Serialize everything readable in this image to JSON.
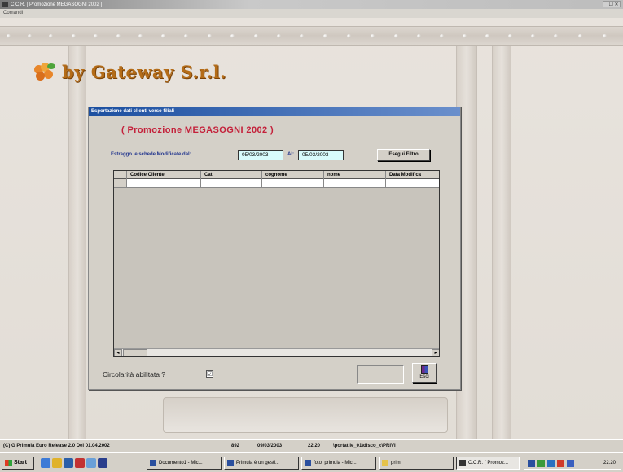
{
  "app": {
    "title": "C.C.R.  [ Promozione MEGASOGNI 2002 ]",
    "menu_item": "Comandi",
    "window_controls": "_ ☐ ✕"
  },
  "brand": {
    "text": "by Gateway S.r.l."
  },
  "dialog": {
    "title": "Esportazione dati clienti verso filiali",
    "promo_title": "( Promozione MEGASOGNI 2002 )",
    "filter_label": "Estraggo le schede Modificate dal:",
    "date_from": "05/03/2003",
    "to_label": "Al:",
    "date_to": "05/03/2003",
    "apply_button": "Esegui Filtro",
    "grid": {
      "columns": [
        "",
        "Codice Cliente",
        "Cat.",
        "cognome",
        "nome",
        "Data Modifica"
      ]
    },
    "circolarita_label": "Circolarità abilitata ?",
    "circolarita_checked": "☑",
    "exit_button": "Esci"
  },
  "statusbar": {
    "release": "(C) G  Primula  Euro Release 2.0   Del  01.04.2002",
    "code": "892",
    "date": "09/03/2003",
    "time": "22.20",
    "user": "\\portatile_01\\disco_c\\PRIVI"
  },
  "taskbar": {
    "start_label": "Start",
    "tasks": [
      "Documento1 - Mic...",
      "Primula è un gesti...",
      "foto_primula - Mic...",
      "prim",
      "C.C.R.  ( Promoz..."
    ],
    "clock": "22.20"
  }
}
